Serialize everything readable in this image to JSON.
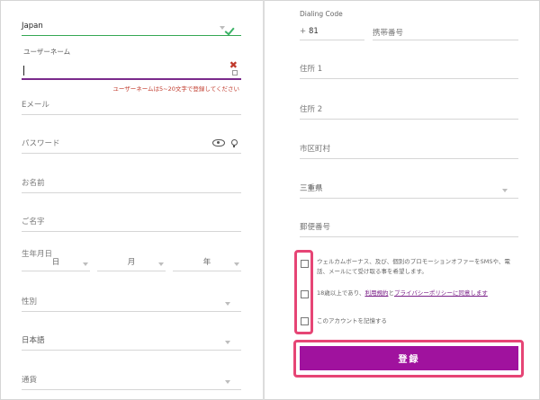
{
  "left": {
    "country": {
      "value": "Japan"
    },
    "username": {
      "label": "ユーザーネーム",
      "value": "",
      "help": "ユーザーネームは5~20文字で登録してください"
    },
    "email": {
      "placeholder": "Eメール"
    },
    "password": {
      "placeholder": "パスワード"
    },
    "first_name": {
      "placeholder": "お名前"
    },
    "last_name": {
      "placeholder": "ご名字"
    },
    "dob": {
      "label": "生年月日",
      "day": "日",
      "month": "月",
      "year": "年"
    },
    "gender": {
      "placeholder": "性別"
    },
    "language": {
      "value": "日本語"
    },
    "currency": {
      "placeholder": "通貨"
    }
  },
  "right": {
    "dialing": {
      "label": "Dialing Code",
      "plus": "+",
      "code": "81",
      "mobile_placeholder": "携帯番号"
    },
    "address1": {
      "placeholder": "住所 1"
    },
    "address2": {
      "placeholder": "住所 2"
    },
    "city": {
      "placeholder": "市区町村"
    },
    "prefecture": {
      "value": "三重県"
    },
    "postcode": {
      "placeholder": "郵便番号"
    },
    "consents": {
      "promo": "ウェルカムボーナス、及び、個別のプロモーションオファーをSMSや、電話、メールにて受け取る事を希望します。",
      "terms_prefix": "18歳以上であり、",
      "terms_link": "利用規約",
      "terms_and": "と",
      "privacy_link": "プライバシーポリシーに同意します",
      "remember": "このアカウントを記憶する"
    },
    "register_button": "登録"
  },
  "colors": {
    "accent": "#a0129e",
    "highlight": "#e64575",
    "valid": "#3bb266",
    "error": "#c0392b"
  }
}
